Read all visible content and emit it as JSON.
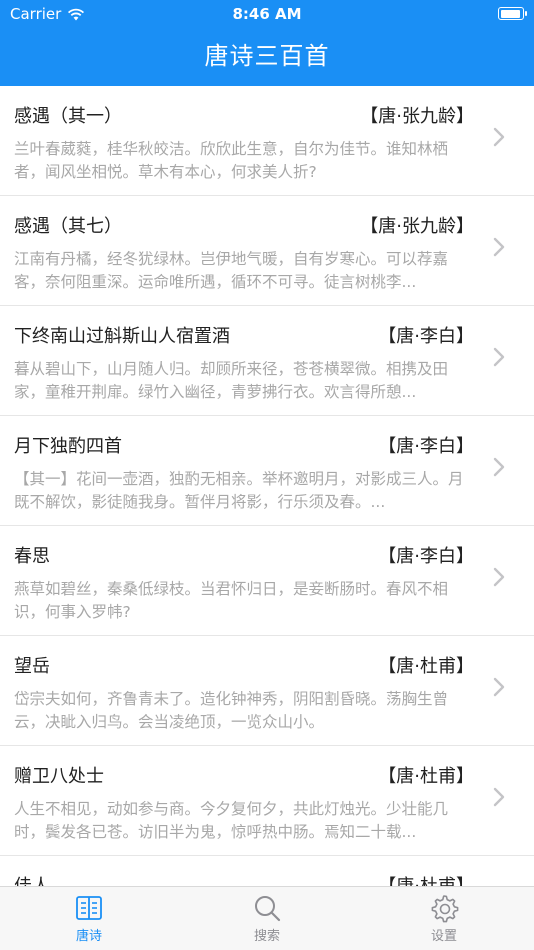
{
  "status_bar": {
    "carrier": "Carrier",
    "time": "8:46 AM"
  },
  "nav": {
    "title": "唐诗三百首"
  },
  "poems": [
    {
      "title": "感遇（其一）",
      "author": "【唐·张九龄】",
      "excerpt": "兰叶春葳蕤，桂华秋皎洁。欣欣此生意，自尔为佳节。谁知林栖者，闻风坐相悦。草木有本心，何求美人折?"
    },
    {
      "title": "感遇（其七）",
      "author": "【唐·张九龄】",
      "excerpt": "江南有丹橘，经冬犹绿林。岂伊地气暖，自有岁寒心。可以荐嘉客，奈何阻重深。运命唯所遇，循环不可寻。徒言树桃李..."
    },
    {
      "title": "下终南山过斛斯山人宿置酒",
      "author": "【唐·李白】",
      "excerpt": "暮从碧山下，山月随人归。却顾所来径，苍苍横翠微。相携及田家，童稚开荆扉。绿竹入幽径，青萝拂行衣。欢言得所憩..."
    },
    {
      "title": "月下独酌四首",
      "author": "【唐·李白】",
      "excerpt": "【其一】花间一壶酒，独酌无相亲。举杯邀明月，对影成三人。月既不解饮，影徒随我身。暂伴月将影，行乐须及春。..."
    },
    {
      "title": "春思",
      "author": "【唐·李白】",
      "excerpt": "燕草如碧丝，秦桑低绿枝。当君怀归日，是妾断肠时。春风不相识，何事入罗帏?"
    },
    {
      "title": "望岳",
      "author": "【唐·杜甫】",
      "excerpt": "岱宗夫如何，齐鲁青未了。造化钟神秀，阴阳割昏晓。荡胸生曾云，决眦入归鸟。会当凌绝顶，一览众山小。"
    },
    {
      "title": "赠卫八处士",
      "author": "【唐·杜甫】",
      "excerpt": "人生不相见，动如参与商。今夕复何夕，共此灯烛光。少壮能几时，鬓发各已苍。访旧半为鬼，惊呼热中肠。焉知二十载..."
    },
    {
      "title": "佳人",
      "author": "【唐·杜甫】",
      "excerpt": ""
    }
  ],
  "tabs": [
    {
      "label": "唐诗",
      "icon": "book-icon"
    },
    {
      "label": "搜索",
      "icon": "search-icon"
    },
    {
      "label": "设置",
      "icon": "gear-icon"
    }
  ],
  "colors": {
    "accent": "#1a8ff5",
    "excerpt": "#a8a8a8"
  }
}
